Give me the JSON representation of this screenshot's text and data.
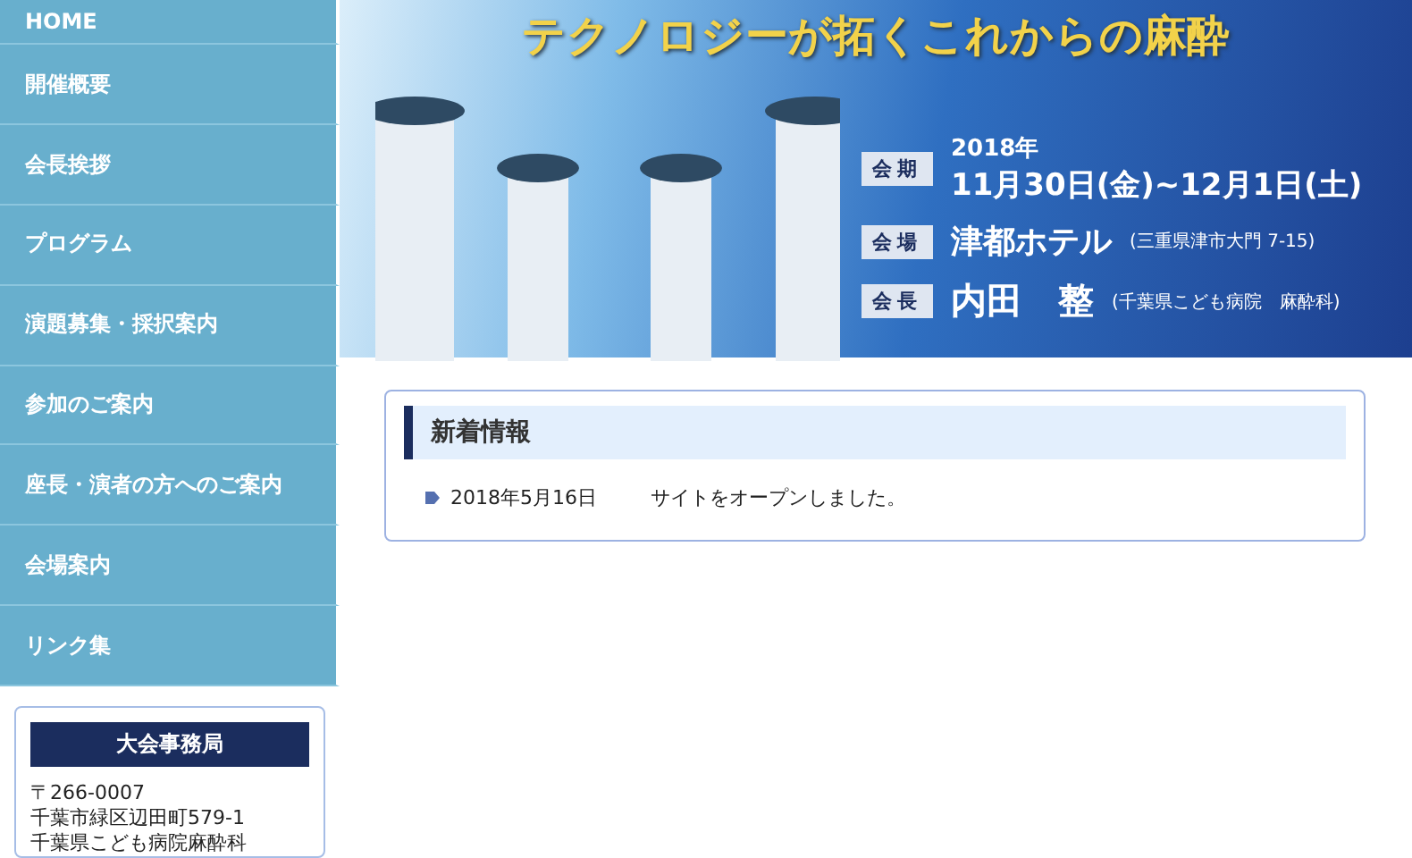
{
  "sidebar": {
    "nav_items": [
      {
        "label": "HOME"
      },
      {
        "label": "開催概要"
      },
      {
        "label": "会長挨拶"
      },
      {
        "label": "プログラム"
      },
      {
        "label": "演題募集・採択案内"
      },
      {
        "label": "参加のご案内"
      },
      {
        "label": "座長・演者の方へのご案内"
      },
      {
        "label": "会場案内"
      },
      {
        "label": "リンク集"
      }
    ],
    "office": {
      "title": "大会事務局",
      "lines": [
        "〒266-0007",
        "千葉市緑区辺田町579-1",
        "千葉県こども病院麻酔科"
      ]
    }
  },
  "banner": {
    "headline": "テクノロジーが拓くこれからの麻酔",
    "rows": [
      {
        "kind": "date",
        "tag": "会期",
        "year": "2018年",
        "main": "11月30日(金)~12月1日(土)"
      },
      {
        "kind": "place",
        "tag": "会場",
        "main": "津都ホテル",
        "note": "(三重県津市大門 7-15)"
      },
      {
        "kind": "person",
        "tag": "会長",
        "main": "内田　整",
        "note": "(千葉県こども病院　麻酔科)"
      }
    ]
  },
  "news": {
    "title": "新着情報",
    "items": [
      {
        "date": "2018年5月16日",
        "text": "サイトをオープンしました。"
      }
    ]
  }
}
